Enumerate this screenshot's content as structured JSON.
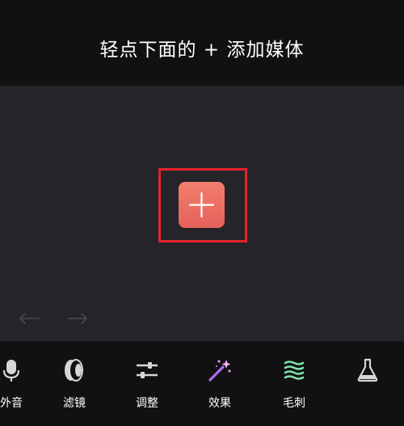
{
  "header": {
    "title": "轻点下面的 + 添加媒体"
  },
  "canvas": {
    "add_button_icon": "plus-icon"
  },
  "history": {
    "undo_icon": "undo-arrow-icon",
    "redo_icon": "redo-arrow-icon"
  },
  "toolbar": {
    "items": [
      {
        "label": "外音",
        "icon": "microphone-icon"
      },
      {
        "label": "滤镜",
        "icon": "filter-icon"
      },
      {
        "label": "调整",
        "icon": "sliders-icon"
      },
      {
        "label": "效果",
        "icon": "magic-wand-icon"
      },
      {
        "label": "毛刺",
        "icon": "glitch-icon"
      },
      {
        "label": "",
        "icon": "flask-icon"
      }
    ]
  },
  "colors": {
    "accent": "#e5615a",
    "highlight": "#e5232c",
    "effect_purple": "#b56cf0",
    "glitch_green": "#7fe3a8"
  }
}
